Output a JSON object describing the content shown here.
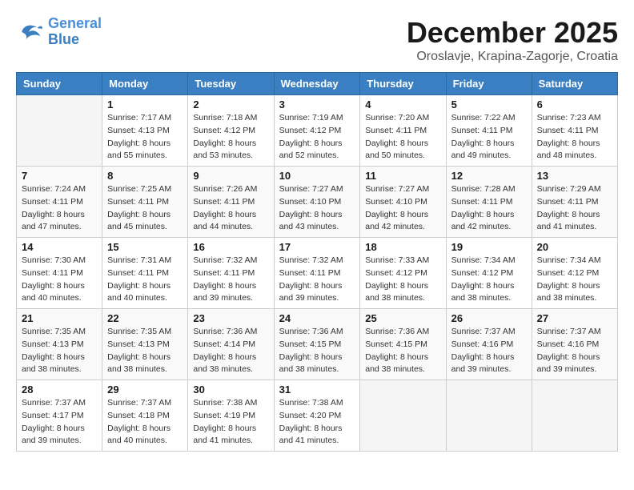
{
  "logo": {
    "line1": "General",
    "line2": "Blue"
  },
  "title": "December 2025",
  "subtitle": "Oroslavje, Krapina-Zagorje, Croatia",
  "days_of_week": [
    "Sunday",
    "Monday",
    "Tuesday",
    "Wednesday",
    "Thursday",
    "Friday",
    "Saturday"
  ],
  "weeks": [
    [
      {
        "day": "",
        "info": ""
      },
      {
        "day": "1",
        "info": "Sunrise: 7:17 AM\nSunset: 4:13 PM\nDaylight: 8 hours\nand 55 minutes."
      },
      {
        "day": "2",
        "info": "Sunrise: 7:18 AM\nSunset: 4:12 PM\nDaylight: 8 hours\nand 53 minutes."
      },
      {
        "day": "3",
        "info": "Sunrise: 7:19 AM\nSunset: 4:12 PM\nDaylight: 8 hours\nand 52 minutes."
      },
      {
        "day": "4",
        "info": "Sunrise: 7:20 AM\nSunset: 4:11 PM\nDaylight: 8 hours\nand 50 minutes."
      },
      {
        "day": "5",
        "info": "Sunrise: 7:22 AM\nSunset: 4:11 PM\nDaylight: 8 hours\nand 49 minutes."
      },
      {
        "day": "6",
        "info": "Sunrise: 7:23 AM\nSunset: 4:11 PM\nDaylight: 8 hours\nand 48 minutes."
      }
    ],
    [
      {
        "day": "7",
        "info": "Sunrise: 7:24 AM\nSunset: 4:11 PM\nDaylight: 8 hours\nand 47 minutes."
      },
      {
        "day": "8",
        "info": "Sunrise: 7:25 AM\nSunset: 4:11 PM\nDaylight: 8 hours\nand 45 minutes."
      },
      {
        "day": "9",
        "info": "Sunrise: 7:26 AM\nSunset: 4:11 PM\nDaylight: 8 hours\nand 44 minutes."
      },
      {
        "day": "10",
        "info": "Sunrise: 7:27 AM\nSunset: 4:10 PM\nDaylight: 8 hours\nand 43 minutes."
      },
      {
        "day": "11",
        "info": "Sunrise: 7:27 AM\nSunset: 4:10 PM\nDaylight: 8 hours\nand 42 minutes."
      },
      {
        "day": "12",
        "info": "Sunrise: 7:28 AM\nSunset: 4:11 PM\nDaylight: 8 hours\nand 42 minutes."
      },
      {
        "day": "13",
        "info": "Sunrise: 7:29 AM\nSunset: 4:11 PM\nDaylight: 8 hours\nand 41 minutes."
      }
    ],
    [
      {
        "day": "14",
        "info": "Sunrise: 7:30 AM\nSunset: 4:11 PM\nDaylight: 8 hours\nand 40 minutes."
      },
      {
        "day": "15",
        "info": "Sunrise: 7:31 AM\nSunset: 4:11 PM\nDaylight: 8 hours\nand 40 minutes."
      },
      {
        "day": "16",
        "info": "Sunrise: 7:32 AM\nSunset: 4:11 PM\nDaylight: 8 hours\nand 39 minutes."
      },
      {
        "day": "17",
        "info": "Sunrise: 7:32 AM\nSunset: 4:11 PM\nDaylight: 8 hours\nand 39 minutes."
      },
      {
        "day": "18",
        "info": "Sunrise: 7:33 AM\nSunset: 4:12 PM\nDaylight: 8 hours\nand 38 minutes."
      },
      {
        "day": "19",
        "info": "Sunrise: 7:34 AM\nSunset: 4:12 PM\nDaylight: 8 hours\nand 38 minutes."
      },
      {
        "day": "20",
        "info": "Sunrise: 7:34 AM\nSunset: 4:12 PM\nDaylight: 8 hours\nand 38 minutes."
      }
    ],
    [
      {
        "day": "21",
        "info": "Sunrise: 7:35 AM\nSunset: 4:13 PM\nDaylight: 8 hours\nand 38 minutes."
      },
      {
        "day": "22",
        "info": "Sunrise: 7:35 AM\nSunset: 4:13 PM\nDaylight: 8 hours\nand 38 minutes."
      },
      {
        "day": "23",
        "info": "Sunrise: 7:36 AM\nSunset: 4:14 PM\nDaylight: 8 hours\nand 38 minutes."
      },
      {
        "day": "24",
        "info": "Sunrise: 7:36 AM\nSunset: 4:15 PM\nDaylight: 8 hours\nand 38 minutes."
      },
      {
        "day": "25",
        "info": "Sunrise: 7:36 AM\nSunset: 4:15 PM\nDaylight: 8 hours\nand 38 minutes."
      },
      {
        "day": "26",
        "info": "Sunrise: 7:37 AM\nSunset: 4:16 PM\nDaylight: 8 hours\nand 39 minutes."
      },
      {
        "day": "27",
        "info": "Sunrise: 7:37 AM\nSunset: 4:16 PM\nDaylight: 8 hours\nand 39 minutes."
      }
    ],
    [
      {
        "day": "28",
        "info": "Sunrise: 7:37 AM\nSunset: 4:17 PM\nDaylight: 8 hours\nand 39 minutes."
      },
      {
        "day": "29",
        "info": "Sunrise: 7:37 AM\nSunset: 4:18 PM\nDaylight: 8 hours\nand 40 minutes."
      },
      {
        "day": "30",
        "info": "Sunrise: 7:38 AM\nSunset: 4:19 PM\nDaylight: 8 hours\nand 41 minutes."
      },
      {
        "day": "31",
        "info": "Sunrise: 7:38 AM\nSunset: 4:20 PM\nDaylight: 8 hours\nand 41 minutes."
      },
      {
        "day": "",
        "info": ""
      },
      {
        "day": "",
        "info": ""
      },
      {
        "day": "",
        "info": ""
      }
    ]
  ]
}
